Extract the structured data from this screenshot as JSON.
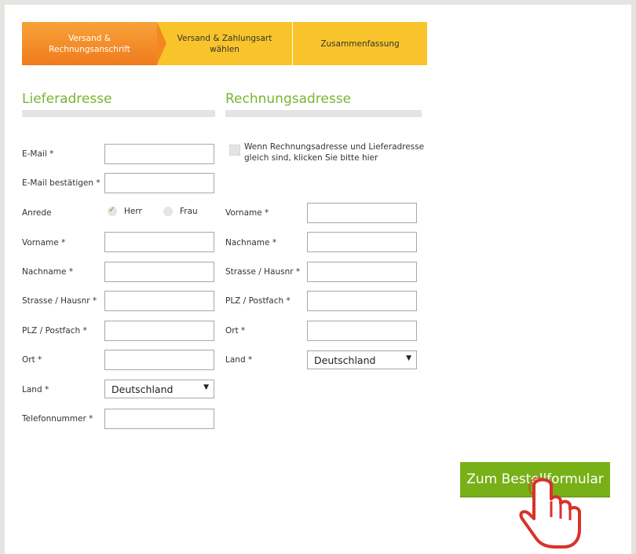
{
  "steps": [
    {
      "label_line1": "Versand &",
      "label_line2": "Rechnungsanschrift"
    },
    {
      "label_line1": "Versand & Zahlungsart",
      "label_line2": "wählen"
    },
    {
      "label_line1": "Zusammenfassung",
      "label_line2": ""
    }
  ],
  "delivery": {
    "title": "Lieferadresse",
    "email_label": "E-Mail *",
    "email_confirm_label": "E-Mail bestätigen *",
    "salutation_label": "Anrede",
    "salutation_options": [
      "Herr",
      "Frau"
    ],
    "salutation_selected": "Herr",
    "first_name_label": "Vorname *",
    "last_name_label": "Nachname *",
    "street_label": "Strasse / Hausnr *",
    "zip_label": "PLZ / Postfach *",
    "city_label": "Ort *",
    "country_label": "Land *",
    "country_value": "Deutschland",
    "phone_label": "Telefonnummer *"
  },
  "billing": {
    "title": "Rechnungsadresse",
    "same_address_text": "Wenn Rechnungsadresse und Lieferadresse gleich sind, klicken Sie bitte hier",
    "first_name_label": "Vorname *",
    "last_name_label": "Nachname *",
    "street_label": "Strasse / Hausnr *",
    "zip_label": "PLZ / Postfach *",
    "city_label": "Ort *",
    "country_label": "Land *",
    "country_value": "Deutschland"
  },
  "submit_label": "Zum Bestellformular",
  "icons": {
    "select_caret": "▼",
    "radio_check": "✓"
  },
  "colors": {
    "accent_green": "#78b017",
    "title_green": "#78b530",
    "step_active": "#f07a1d",
    "step_inactive": "#f9c42b"
  }
}
